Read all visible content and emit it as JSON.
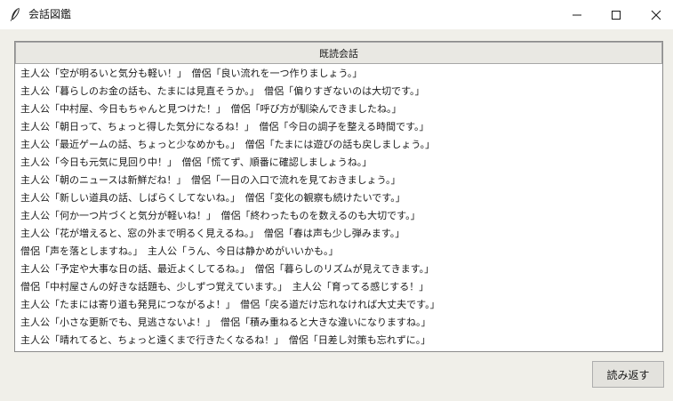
{
  "window": {
    "title": "会話図鑑",
    "icon": "feather-icon"
  },
  "list": {
    "header": "既読会話",
    "rows": [
      "主人公「空が明るいと気分も軽い！」　僧侶「良い流れを一つ作りましょう。」",
      "主人公「暮らしのお金の話も、たまには見直そうか。」　僧侶「偏りすぎないのは大切です。」",
      "主人公「中村屋、今日もちゃんと見つけた！」　僧侶「呼び方が馴染んできましたね。」",
      "主人公「朝日って、ちょっと得した気分になるね！」　僧侶「今日の調子を整える時間です。」",
      "主人公「最近ゲームの話、ちょっと少なめかも。」　僧侶「たまには遊びの話も戻しましょう。」",
      "主人公「今日も元気に見回り中！」　僧侶「慌てず、順番に確認しましょうね。」",
      "主人公「朝のニュースは新鮮だね！」　僧侶「一日の入口で流れを見ておきましょう。」",
      "主人公「新しい道具の話、しばらくしてないね。」　僧侶「変化の観察も続けたいです。」",
      "主人公「何か一つ片づくと気分が軽いね！」　僧侶「終わったものを数えるのも大切です。」",
      "主人公「花が増えると、窓の外まで明るく見えるね。」　僧侶「春は声も少し弾みます。」",
      "僧侶「声を落としますね。」　主人公「うん、今日は静かめがいいかも。」",
      "主人公「予定や大事な日の話、最近よくしてるね。」　僧侶「暮らしのリズムが見えてきます。」",
      "僧侶「中村屋さんの好きな話題も、少しずつ覚えています。」　主人公「育ってる感じする！」",
      "主人公「たまには寄り道も発見につながるよ！」　僧侶「戻る道だけ忘れなければ大丈夫です。」",
      "主人公「小さな更新でも、見逃さないよ！」　僧侶「積み重ねると大きな違いになりますね。」",
      "主人公「晴れてると、ちょっと遠くまで行きたくなるね！」　僧侶「日差し対策も忘れずに。」"
    ]
  },
  "buttons": {
    "reread": "読み返す"
  }
}
